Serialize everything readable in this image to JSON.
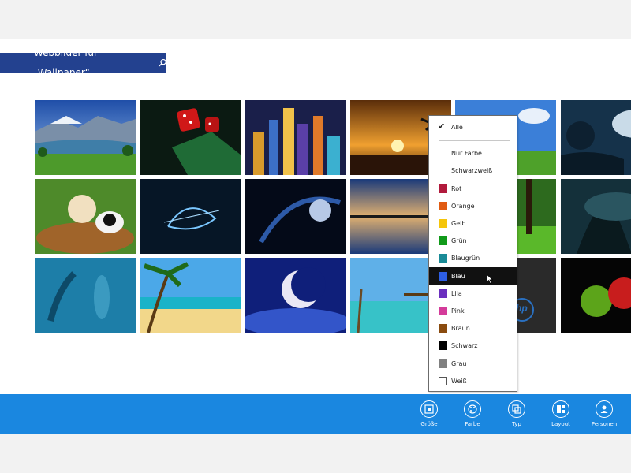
{
  "search": {
    "label": "Webbilder für „Wallpaper“"
  },
  "filter_menu": {
    "top_items": [
      {
        "label": "Alle",
        "checked": true
      }
    ],
    "items": [
      {
        "label": "Nur Farbe",
        "color": null
      },
      {
        "label": "Schwarzweiß",
        "color": null
      },
      {
        "label": "Rot",
        "color": "#b11a3c"
      },
      {
        "label": "Orange",
        "color": "#e15b12"
      },
      {
        "label": "Gelb",
        "color": "#f5c50a"
      },
      {
        "label": "Grün",
        "color": "#119a1a"
      },
      {
        "label": "Blaugrün",
        "color": "#1a8b97"
      },
      {
        "label": "Blau",
        "color": "#2d5ee3",
        "selected": true
      },
      {
        "label": "Lila",
        "color": "#6b2fbf"
      },
      {
        "label": "Pink",
        "color": "#d43b9a"
      },
      {
        "label": "Braun",
        "color": "#8a4b0f"
      },
      {
        "label": "Schwarz",
        "color": "#000000"
      },
      {
        "label": "Grau",
        "color": "#808080"
      },
      {
        "label": "Weiß",
        "color": "#ffffff"
      }
    ]
  },
  "appbar": {
    "buttons": [
      {
        "label": "Größe",
        "icon": "size-icon"
      },
      {
        "label": "Farbe",
        "icon": "palette-icon"
      },
      {
        "label": "Typ",
        "icon": "type-icon"
      },
      {
        "label": "Layout",
        "icon": "layout-icon"
      },
      {
        "label": "Personen",
        "icon": "person-icon"
      }
    ]
  },
  "thumbnail_brand_text": "hp",
  "colors": {
    "accent_header": "#23418f",
    "appbar": "#1a87e0"
  }
}
